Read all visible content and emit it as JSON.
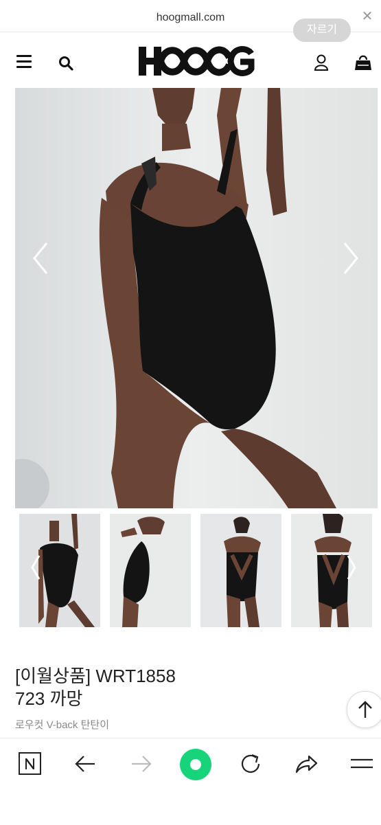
{
  "browser": {
    "url": "hoogmall.com",
    "crop_label": "자르기",
    "close_icon": "close-icon"
  },
  "header": {
    "logo_text": "HOOG",
    "menu_icon": "hamburger-menu-icon",
    "search_icon": "search-icon",
    "user_icon": "user-icon",
    "bag_icon": "shopping-bag-icon"
  },
  "product": {
    "title_line1": "[이월상품] WRT1858",
    "title_line2": "723 까망",
    "subtitle": "로우컷 V-back 탄탄이",
    "thumbnail_count": 4
  },
  "bottom_nav": {
    "icons": [
      "naver-n-icon",
      "back-arrow-icon",
      "forward-arrow-icon",
      "green-home-dot-icon",
      "reload-icon",
      "share-icon",
      "menu-icon"
    ]
  },
  "colors": {
    "accent_green": "#17d47a",
    "text_dark": "#222222",
    "subtitle_gray": "#888888"
  }
}
